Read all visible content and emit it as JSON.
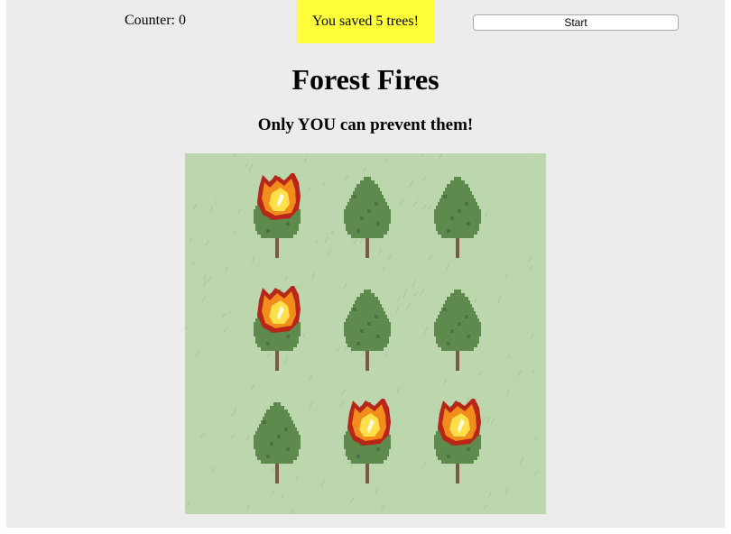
{
  "header": {
    "counter_label": "Counter: 0",
    "message": "You saved 5 trees!",
    "start_label": "Start"
  },
  "title": "Forest Fires",
  "subtitle": "Only YOU can prevent them!",
  "colors": {
    "page_bg": "#ececec",
    "message_bg": "#ffff3a",
    "grass": "#bcd6ae",
    "tree": "#5f8a4e",
    "trunk": "#7a5a40",
    "fire_outline": "#b8261a",
    "fire_orange": "#f28c1b",
    "fire_yellow": "#ffe04a"
  },
  "grid": {
    "rows": 3,
    "cols": 3,
    "cells": [
      {
        "row": 0,
        "col": 0,
        "state": "burning"
      },
      {
        "row": 0,
        "col": 1,
        "state": "tree"
      },
      {
        "row": 0,
        "col": 2,
        "state": "tree"
      },
      {
        "row": 1,
        "col": 0,
        "state": "burning"
      },
      {
        "row": 1,
        "col": 1,
        "state": "tree"
      },
      {
        "row": 1,
        "col": 2,
        "state": "tree"
      },
      {
        "row": 2,
        "col": 0,
        "state": "tree"
      },
      {
        "row": 2,
        "col": 1,
        "state": "burning"
      },
      {
        "row": 2,
        "col": 2,
        "state": "burning"
      }
    ]
  }
}
